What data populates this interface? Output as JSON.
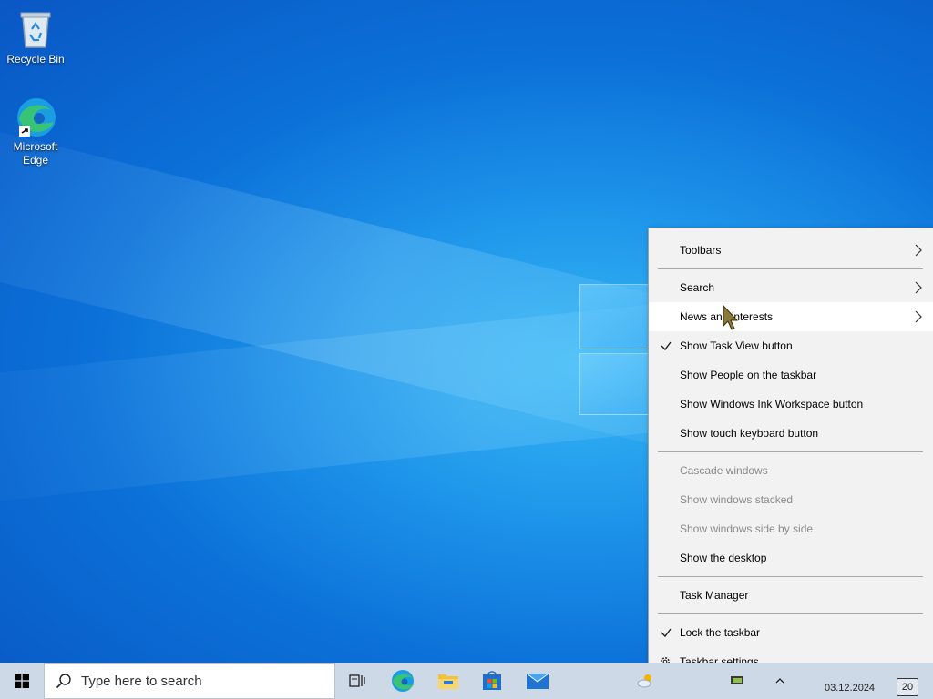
{
  "desktop": {
    "icons": [
      {
        "label": "Recycle Bin",
        "icon": "recycle-bin-icon"
      },
      {
        "label": "Microsoft Edge",
        "icon": "edge-icon"
      }
    ]
  },
  "context_menu": {
    "items": [
      {
        "label": "Toolbars",
        "submenu": true
      },
      {
        "label": "Search",
        "submenu": true
      },
      {
        "label": "News and interests",
        "submenu": true,
        "highlighted": true
      },
      {
        "label": "Show Task View button",
        "checked": true
      },
      {
        "label": "Show People on the taskbar"
      },
      {
        "label": "Show Windows Ink Workspace button"
      },
      {
        "label": "Show touch keyboard button"
      },
      {
        "label": "Cascade windows",
        "disabled": true
      },
      {
        "label": "Show windows stacked",
        "disabled": true
      },
      {
        "label": "Show windows side by side",
        "disabled": true
      },
      {
        "label": "Show the desktop"
      },
      {
        "label": "Task Manager"
      },
      {
        "label": "Lock the taskbar",
        "checked": true
      },
      {
        "label": "Taskbar settings",
        "icon": "gear-icon"
      }
    ]
  },
  "taskbar": {
    "search_placeholder": "Type here to search",
    "pinned": [
      "task-view-icon",
      "edge-icon",
      "file-explorer-icon",
      "store-icon",
      "mail-icon"
    ],
    "date": "03.12.2024",
    "notification_count": "20"
  },
  "colors": {
    "accent": "#0078d7",
    "menu_bg": "#f2f2f2",
    "taskbar_bg": "#cdd9e6"
  }
}
